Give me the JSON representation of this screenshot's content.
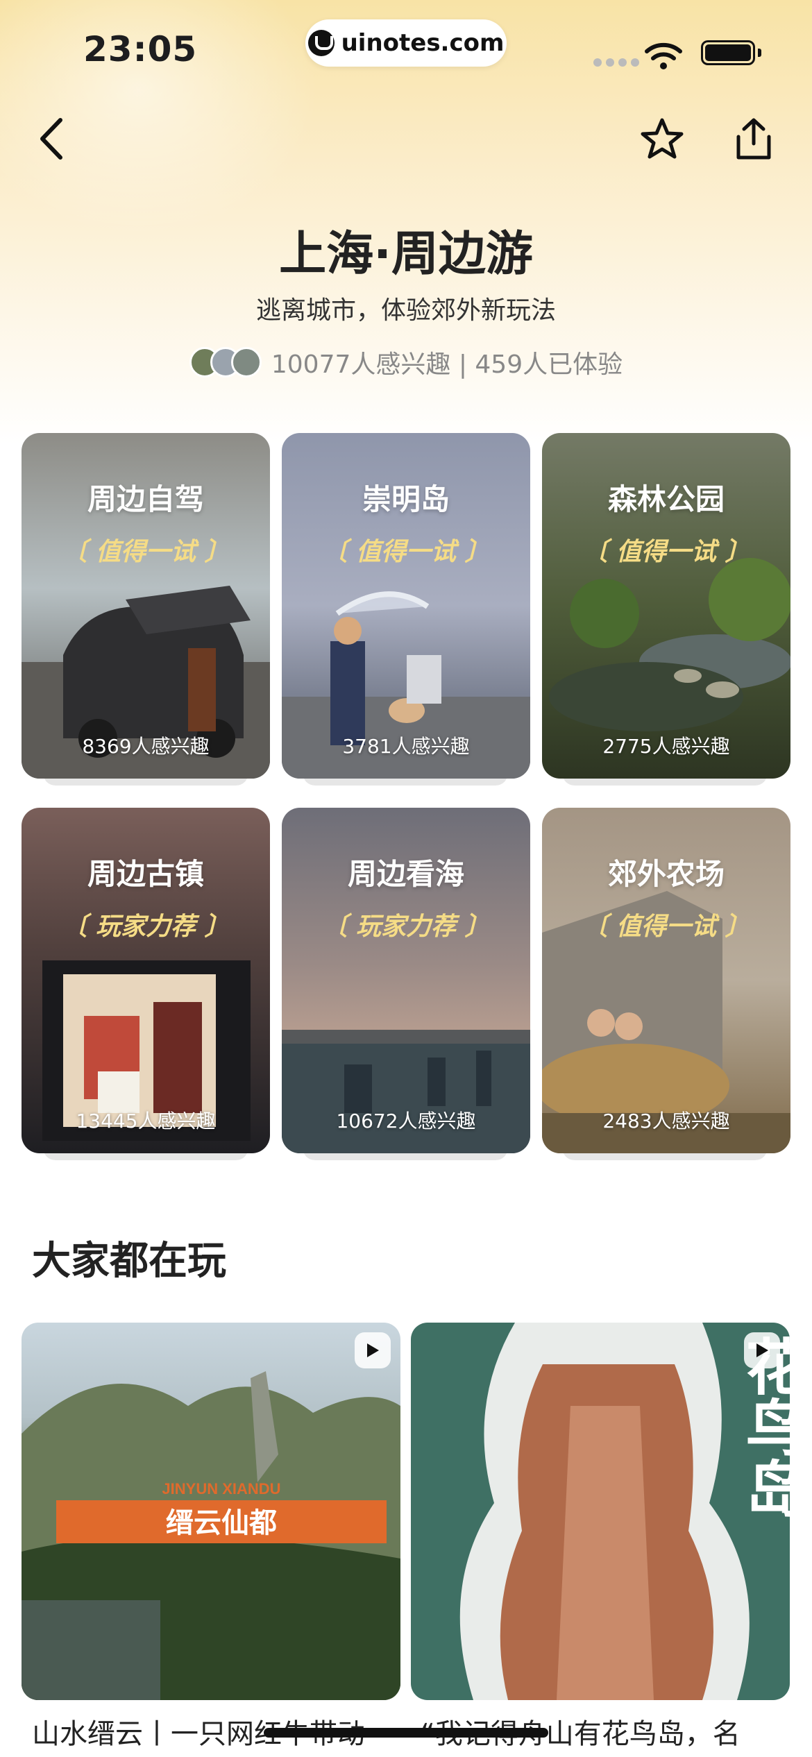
{
  "status_bar": {
    "time": "23:05",
    "url": "uinotes.com"
  },
  "header": {
    "title": "上海·周边游",
    "subtitle": "逃离城市，体验郊外新玩法",
    "stats": "10077人感兴趣 | 459人已体验"
  },
  "categories": [
    {
      "title": "周边自驾",
      "tag": "〔 值得一试 〕",
      "count": "8369人感兴趣"
    },
    {
      "title": "崇明岛",
      "tag": "〔 值得一试 〕",
      "count": "3781人感兴趣"
    },
    {
      "title": "森林公园",
      "tag": "〔 值得一试 〕",
      "count": "2775人感兴趣"
    },
    {
      "title": "周边古镇",
      "tag": "〔 玩家力荐 〕",
      "count": "13445人感兴趣"
    },
    {
      "title": "周边看海",
      "tag": "〔 玩家力荐 〕",
      "count": "10672人感兴趣"
    },
    {
      "title": "郊外农场",
      "tag": "〔 值得一试 〕",
      "count": "2483人感兴趣"
    }
  ],
  "section": {
    "title": "大家都在玩"
  },
  "feed": [
    {
      "overlay_en": "JINYUN XIANDU",
      "overlay_cn": "缙云仙都",
      "caption": "山水缙云丨一只网红牛带动"
    },
    {
      "overlay_cn": "花鸟岛",
      "caption": "“我记得舟山有花鸟岛，名"
    }
  ],
  "icons": [
    "back-icon",
    "star-icon",
    "share-icon",
    "play-icon",
    "wifi-icon",
    "battery-icon"
  ]
}
